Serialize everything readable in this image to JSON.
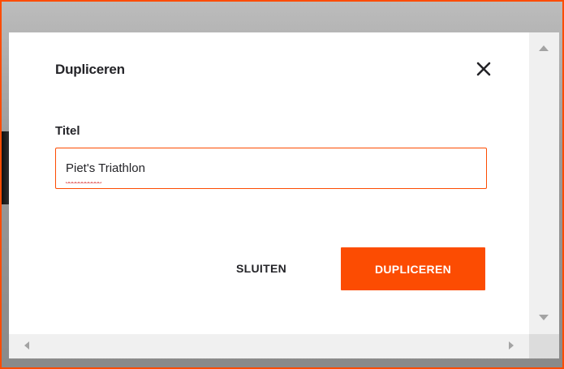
{
  "dialog": {
    "title": "Dupliceren",
    "close_icon": "close-icon"
  },
  "form": {
    "title_label": "Titel",
    "title_value": "Piet's Triathlon"
  },
  "actions": {
    "close_label": "SLUITEN",
    "duplicate_label": "DUPLICEREN"
  },
  "colors": {
    "accent": "#fc4c02",
    "text": "#242428",
    "scrollbar": "#f0f0f0"
  },
  "scrollbars": {
    "up_icon": "chevron-up-icon",
    "down_icon": "chevron-down-icon",
    "left_icon": "chevron-left-icon",
    "right_icon": "chevron-right-icon"
  }
}
